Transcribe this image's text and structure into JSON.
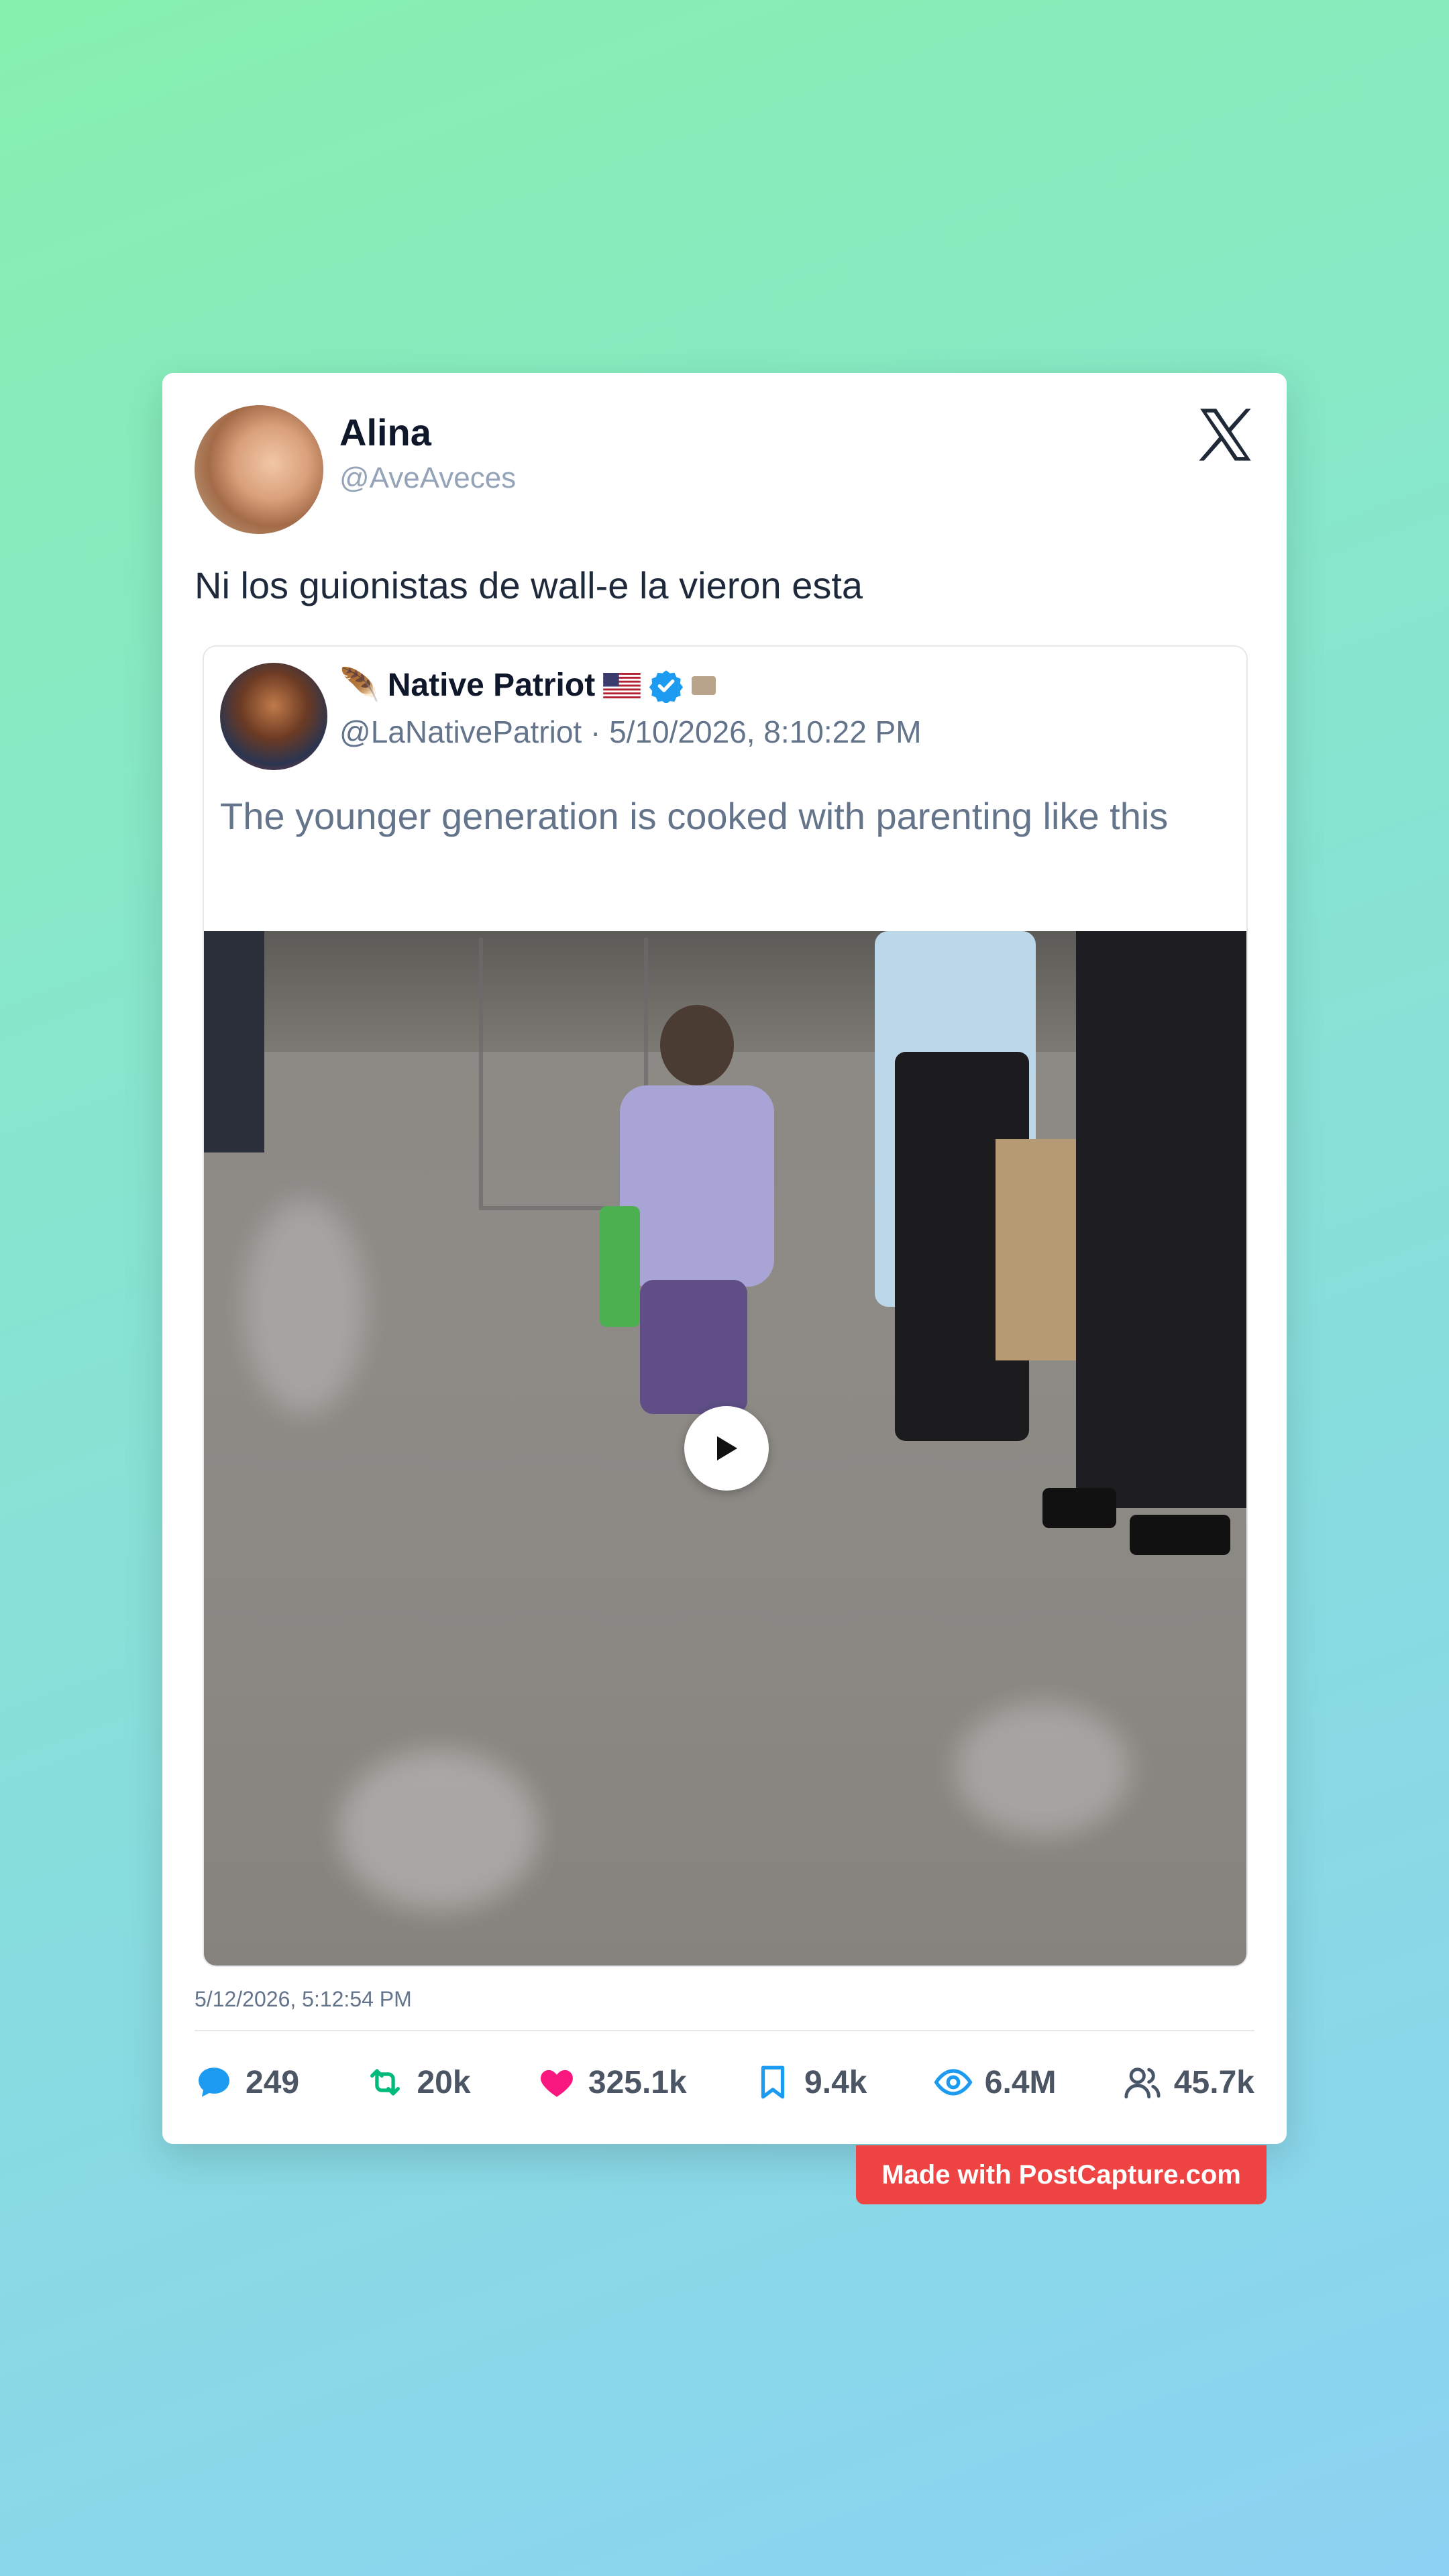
{
  "tweet": {
    "author_name": "Alina",
    "author_handle": "@AveAveces",
    "text": "Ni los guionistas de wall-e la vieron esta",
    "timestamp": "5/12/2026, 5:12:54 PM"
  },
  "quoted": {
    "author_name": "Native Patriot",
    "author_handle": "@LaNativePatriot",
    "separator": "·",
    "datetime": "5/10/2026, 8:10:22 PM",
    "text": "The younger generation is cooked with parenting like this",
    "name_emoji_prefix": "🪶",
    "icons": [
      "feather-icon",
      "us-flag-icon",
      "verified-badge-icon",
      "small-badge-icon"
    ]
  },
  "stats": {
    "replies": "249",
    "retweets": "20k",
    "likes": "325.1k",
    "bookmarks": "9.4k",
    "views": "6.4M",
    "followers": "45.7k"
  },
  "colors": {
    "reply": "#1d9bf0",
    "retweet": "#00ba7c",
    "like": "#f91880",
    "bookmark": "#1d9bf0",
    "views": "#1d9bf0",
    "followers": "#475569",
    "watermark": "#ef4444"
  },
  "watermark": "Made with PostCapture.com"
}
